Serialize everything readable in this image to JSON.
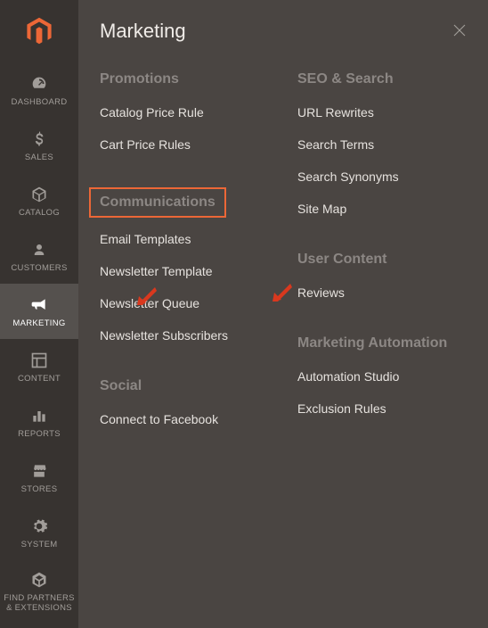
{
  "sidebar": {
    "items": [
      {
        "label": "DASHBOARD"
      },
      {
        "label": "SALES"
      },
      {
        "label": "CATALOG"
      },
      {
        "label": "CUSTOMERS"
      },
      {
        "label": "MARKETING"
      },
      {
        "label": "CONTENT"
      },
      {
        "label": "REPORTS"
      },
      {
        "label": "STORES"
      },
      {
        "label": "SYSTEM"
      },
      {
        "label": "FIND PARTNERS & EXTENSIONS"
      }
    ]
  },
  "flyout": {
    "title": "Marketing",
    "left_sections": [
      {
        "heading": "Promotions",
        "links": [
          "Catalog Price Rule",
          "Cart Price Rules"
        ]
      },
      {
        "heading": "Communications",
        "highlighted": true,
        "links": [
          "Email Templates",
          "Newsletter Template",
          "Newsletter Queue",
          "Newsletter Subscribers"
        ]
      },
      {
        "heading": "Social",
        "links": [
          "Connect to Facebook"
        ]
      }
    ],
    "right_sections": [
      {
        "heading": "SEO & Search",
        "links": [
          "URL Rewrites",
          "Search Terms",
          "Search Synonyms",
          "Site Map"
        ]
      },
      {
        "heading": "User Content",
        "links": [
          "Reviews"
        ]
      },
      {
        "heading": "Marketing Automation",
        "links": [
          "Automation Studio",
          "Exclusion Rules"
        ]
      }
    ]
  }
}
